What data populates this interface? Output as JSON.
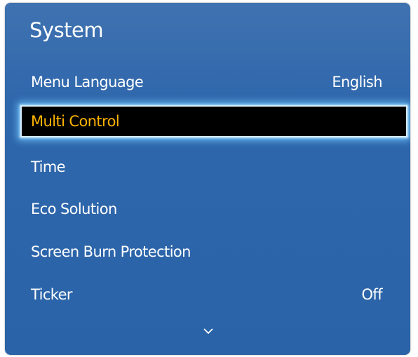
{
  "menu": {
    "title": "System",
    "items": [
      {
        "label": "Menu Language",
        "value": "English",
        "selected": false
      },
      {
        "label": "Multi Control",
        "value": "",
        "selected": true
      },
      {
        "label": "Time",
        "value": "",
        "selected": false
      },
      {
        "label": "Eco Solution",
        "value": "",
        "selected": false
      },
      {
        "label": "Screen Burn Protection",
        "value": "",
        "selected": false
      },
      {
        "label": "Ticker",
        "value": "Off",
        "selected": false
      }
    ],
    "scroll_indicator": "chevron-down-icon"
  },
  "colors": {
    "panel_bg": "#2f67ac",
    "text": "#ffffff",
    "selected_bg": "#000000",
    "selected_text": "#ffb400",
    "focus_glow": "#6ec8ff"
  }
}
